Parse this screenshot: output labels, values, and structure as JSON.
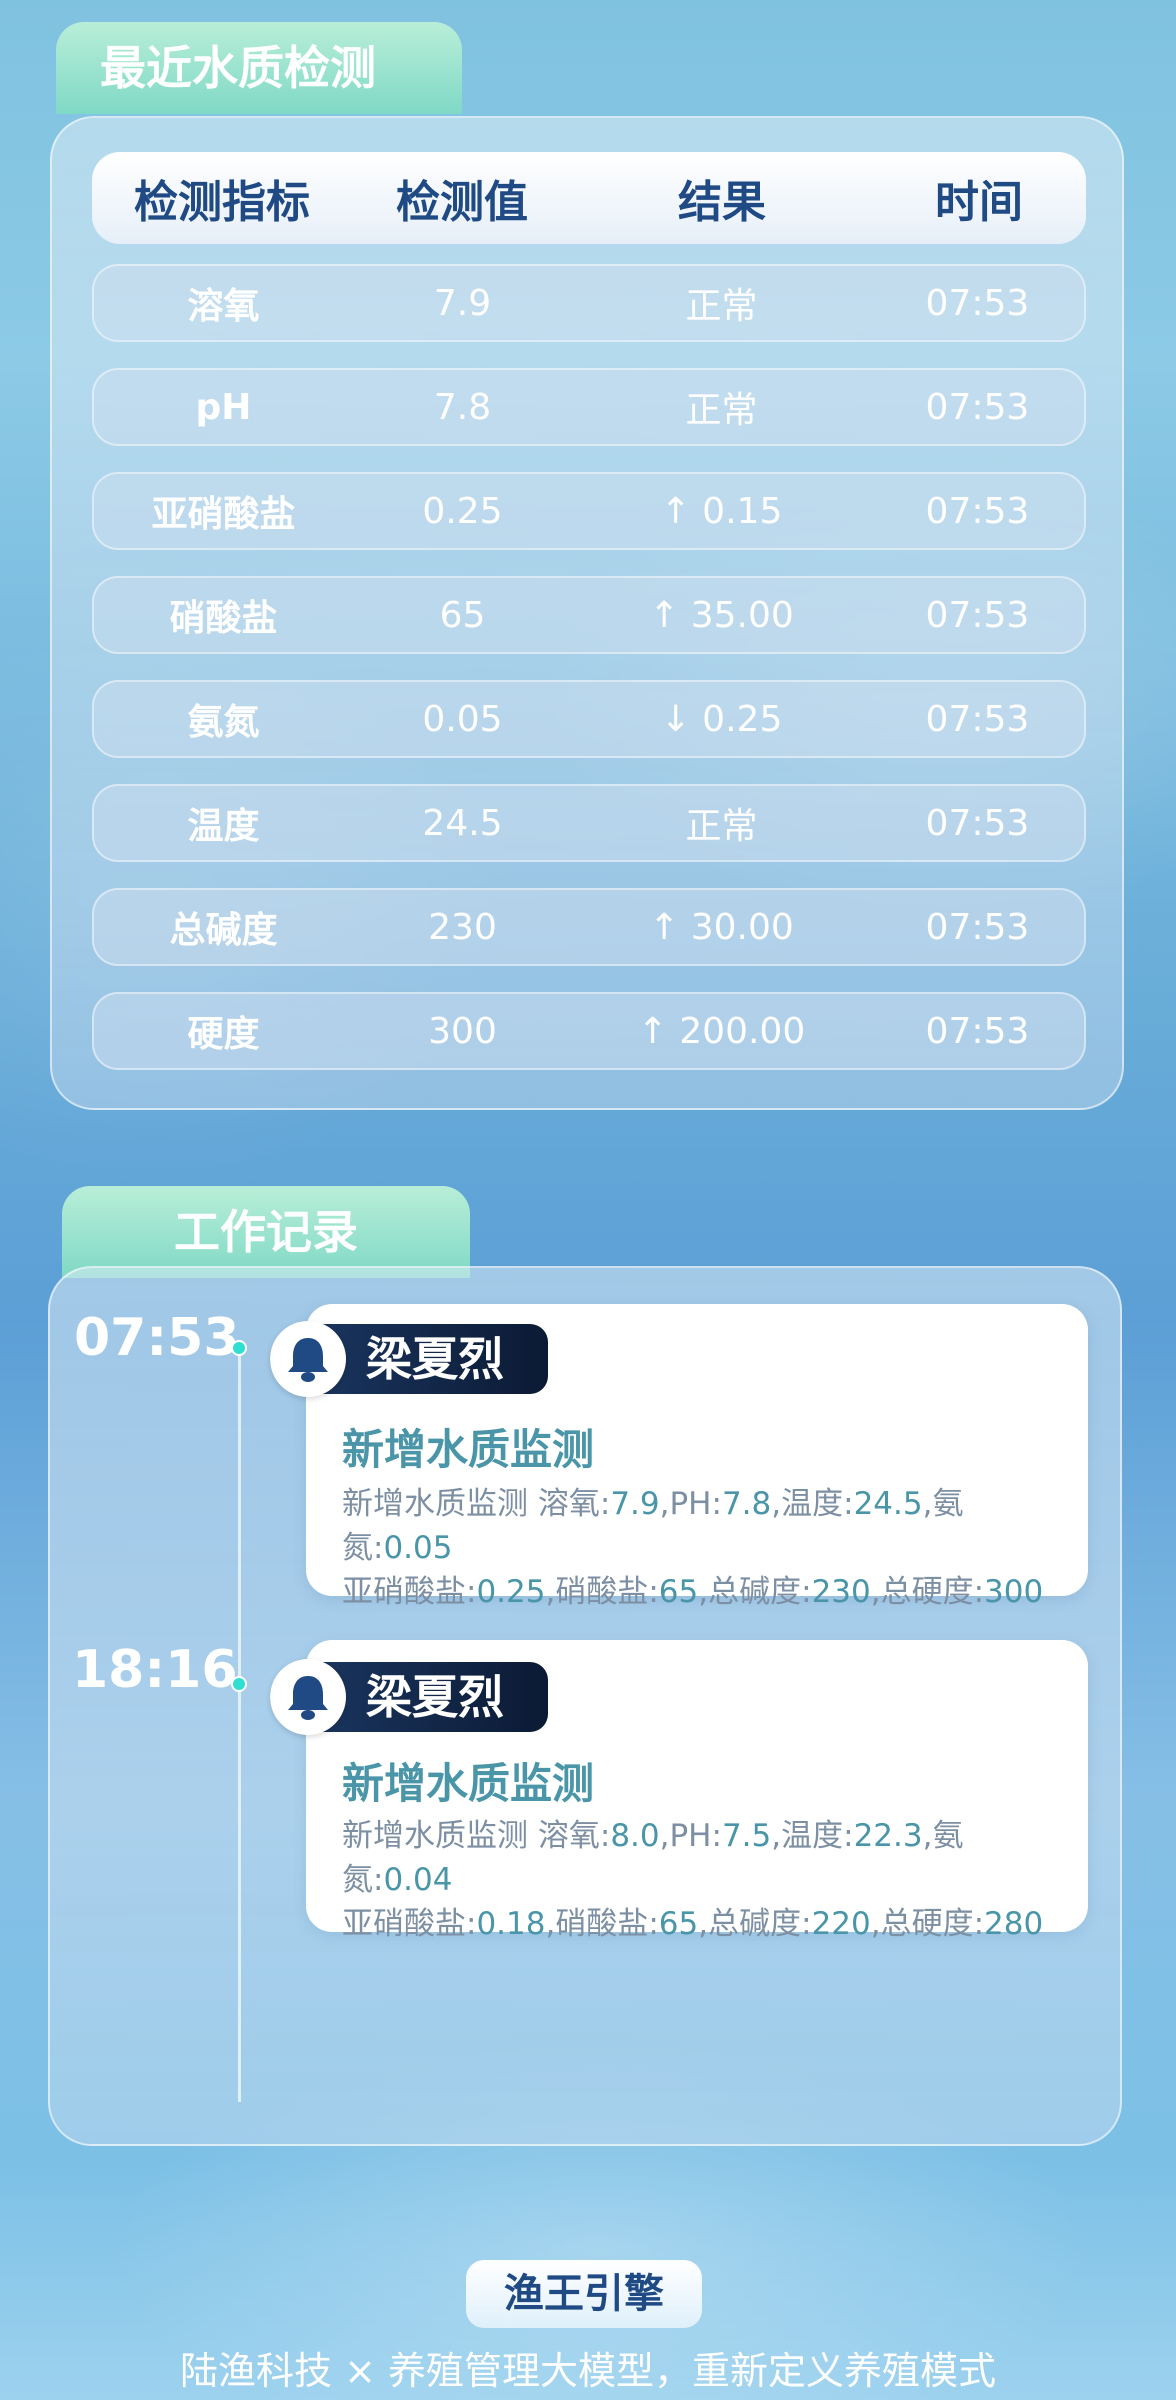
{
  "quality": {
    "title": "最近水质检测",
    "headers": [
      "检测指标",
      "检测值",
      "结果",
      "时间"
    ],
    "rows": [
      {
        "name": "溶氧",
        "value": "7.9",
        "result": "正常",
        "time": "07:53"
      },
      {
        "name": "pH",
        "value": "7.8",
        "result": "正常",
        "time": "07:53"
      },
      {
        "name": "亚硝酸盐",
        "value": "0.25",
        "result": "↑ 0.15",
        "time": "07:53"
      },
      {
        "name": "硝酸盐",
        "value": "65",
        "result": "↑ 35.00",
        "time": "07:53"
      },
      {
        "name": "氨氮",
        "value": "0.05",
        "result": "↓ 0.25",
        "time": "07:53"
      },
      {
        "name": "温度",
        "value": "24.5",
        "result": "正常",
        "time": "07:53"
      },
      {
        "name": "总碱度",
        "value": "230",
        "result": "↑ 30.00",
        "time": "07:53"
      },
      {
        "name": "硬度",
        "value": "300",
        "result": "↑ 200.00",
        "time": "07:53"
      }
    ]
  },
  "work": {
    "title": "工作记录",
    "records": [
      {
        "time": "07:53",
        "user": "梁夏烈",
        "title": "新增水质监测",
        "line1_label": "新增水质监测 溶氧:",
        "line1": [
          [
            "7.9",
            ",PH:"
          ],
          [
            "7.8",
            ",温度:"
          ],
          [
            "24.5",
            ",氨氮:"
          ],
          [
            "0.05",
            ""
          ]
        ],
        "line2_label": "亚硝酸盐:",
        "line2": [
          [
            "0.25",
            ",硝酸盐:"
          ],
          [
            "65",
            ",总碱度:"
          ],
          [
            "230",
            ",总硬度:"
          ],
          [
            "300",
            ""
          ]
        ],
        "icon": "bell-icon"
      },
      {
        "time": "18:16",
        "user": "梁夏烈",
        "title": "新增水质监测",
        "line1_label": "新增水质监测 溶氧:",
        "line1": [
          [
            "8.0",
            ",PH:"
          ],
          [
            "7.5",
            ",温度:"
          ],
          [
            "22.3",
            ",氨氮:"
          ],
          [
            "0.04",
            ""
          ]
        ],
        "line2_label": "亚硝酸盐:",
        "line2": [
          [
            "0.18",
            ",硝酸盐:"
          ],
          [
            "65",
            ",总碱度:"
          ],
          [
            "220",
            ",总硬度:"
          ],
          [
            "280",
            ""
          ]
        ],
        "icon": "bell-icon"
      }
    ]
  },
  "footer": {
    "brand": "渔王引擎",
    "slogan": "陆渔科技 × 养殖管理大模型，重新定义养殖模式"
  },
  "colors": {
    "accent_teal": "#4a96a8",
    "header_navy": "#1f4a84",
    "tab_green": "#7fd9c6",
    "dot_cyan": "#2fe0d2"
  }
}
